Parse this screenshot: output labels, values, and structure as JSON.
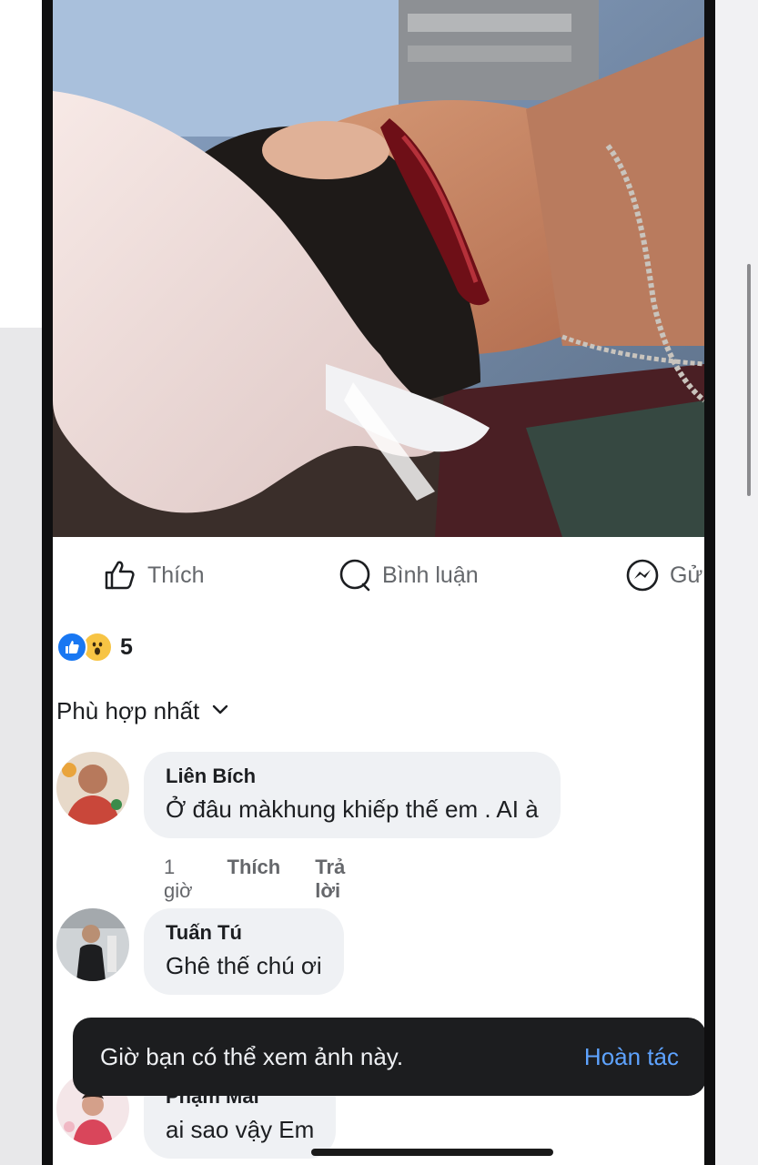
{
  "post": {
    "actions": {
      "like_label": "Thích",
      "comment_label": "Bình luận",
      "send_label": "Gử"
    },
    "reactions": {
      "icons": [
        "like-icon",
        "wow-icon"
      ],
      "count": "5"
    },
    "sort_label": "Phù hợp nhất"
  },
  "comments": [
    {
      "author": "Liên Bích",
      "text": "Ở đâu màkhung khiếp thế em . AI à",
      "time": "1 giờ",
      "like_label": "Thích",
      "reply_label": "Trả lời"
    },
    {
      "author": "Tuấn Tú",
      "text": "Ghê thế chú ơi"
    },
    {
      "author": "Phạm Mai",
      "text": "ai sao vậy Em"
    }
  ],
  "toast": {
    "message": "Giờ bạn có thể xem ảnh này.",
    "action_label": "Hoàn tác"
  },
  "colors": {
    "accent": "#1877f2",
    "link": "#5ea3ff",
    "bubble": "#eff1f4",
    "toast_bg": "#1c1d1f"
  }
}
